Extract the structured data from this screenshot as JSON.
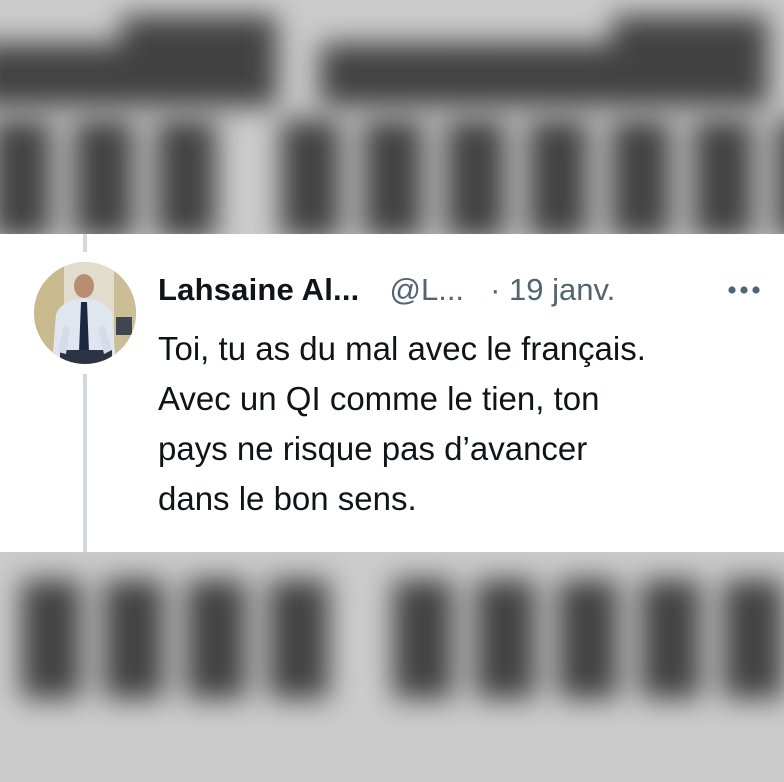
{
  "tweet": {
    "display_name": "Lahsaine Al...",
    "handle": "@L...",
    "date": "· 19 janv.",
    "more_icon": "more-horizontal-icon",
    "lines": [
      "Toi, tu as du mal avec le français.",
      "Avec un QI comme le tien, ton",
      "pays ne risque pas d’avancer",
      "dans le bon sens."
    ]
  },
  "colors": {
    "text_primary": "#0f1419",
    "text_secondary": "#536471",
    "thread_line": "#cfd9de",
    "card_bg": "#ffffff"
  }
}
